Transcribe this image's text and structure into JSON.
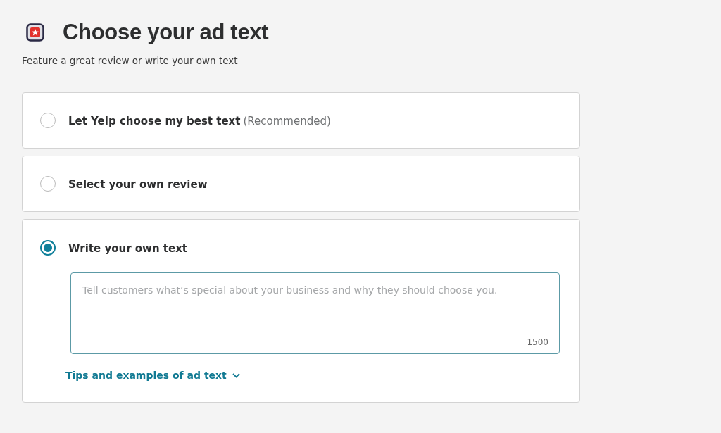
{
  "header": {
    "title": "Choose your ad text",
    "subtitle": "Feature a great review or write your own text"
  },
  "options": [
    {
      "label": "Let Yelp choose my best text",
      "note": "(Recommended)",
      "selected": false
    },
    {
      "label": "Select your own review",
      "selected": false
    },
    {
      "label": "Write your own text",
      "selected": true,
      "textarea": {
        "placeholder": "Tell customers what’s special about your business and why they should choose you.",
        "counter": "1500"
      },
      "link": "Tips and examples of ad text"
    }
  ]
}
